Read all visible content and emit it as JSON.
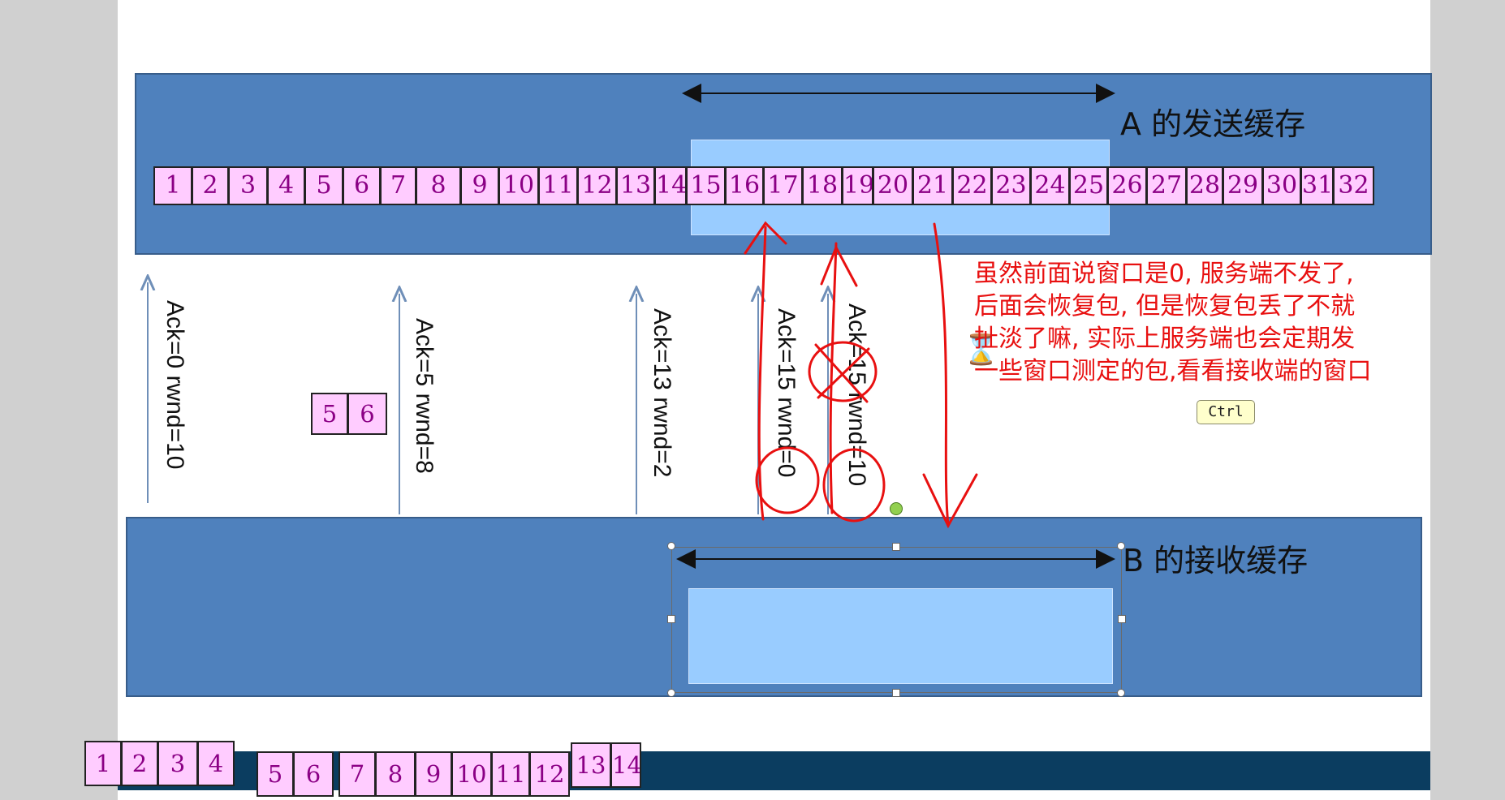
{
  "slide": {
    "send_buffer_title": "A 的发送缓存",
    "recv_buffer_title": "B 的接收缓存",
    "send_buffer_cells": [
      "1",
      "2",
      "3",
      "4",
      "5",
      "6",
      "7",
      "8",
      "9",
      "10",
      "11",
      "12",
      "13",
      "14",
      "15",
      "16",
      "17",
      "18",
      "19",
      "20",
      "21",
      "22",
      "23",
      "24",
      "25",
      "26",
      "27",
      "28",
      "29",
      "30",
      "31",
      "32"
    ],
    "floating_cells": [
      "5",
      "6"
    ],
    "bottom_cells": [
      "1",
      "2",
      "3",
      "4",
      "5",
      "6",
      "7",
      "8",
      "9",
      "10",
      "11",
      "12",
      "13",
      "14"
    ],
    "acks": [
      "Ack=0 rwnd=10",
      "Ack=5 rwnd=8",
      "Ack=13 rwnd=2",
      "Ack=15 rwnd=0",
      "Ack=15 rwnd=10"
    ]
  },
  "annotation": {
    "lines": [
      "虽然前面说窗口是0, 服务端不发了,",
      "后面会恢复包, 但是恢复包丢了不就",
      "扯淡了嘛, 实际上服务端也会定期发",
      "一些窗口测定的包,看看接收端的窗口"
    ]
  },
  "ctrl_badge": "Ctrl",
  "colors": {
    "band": "#4f81bd",
    "window": "#99ccff",
    "cell_fill": "#ffccff",
    "cell_text": "#8b0085",
    "annotation": "#e81010"
  },
  "icons": {
    "busy_cursor": "hourglass-icon"
  }
}
